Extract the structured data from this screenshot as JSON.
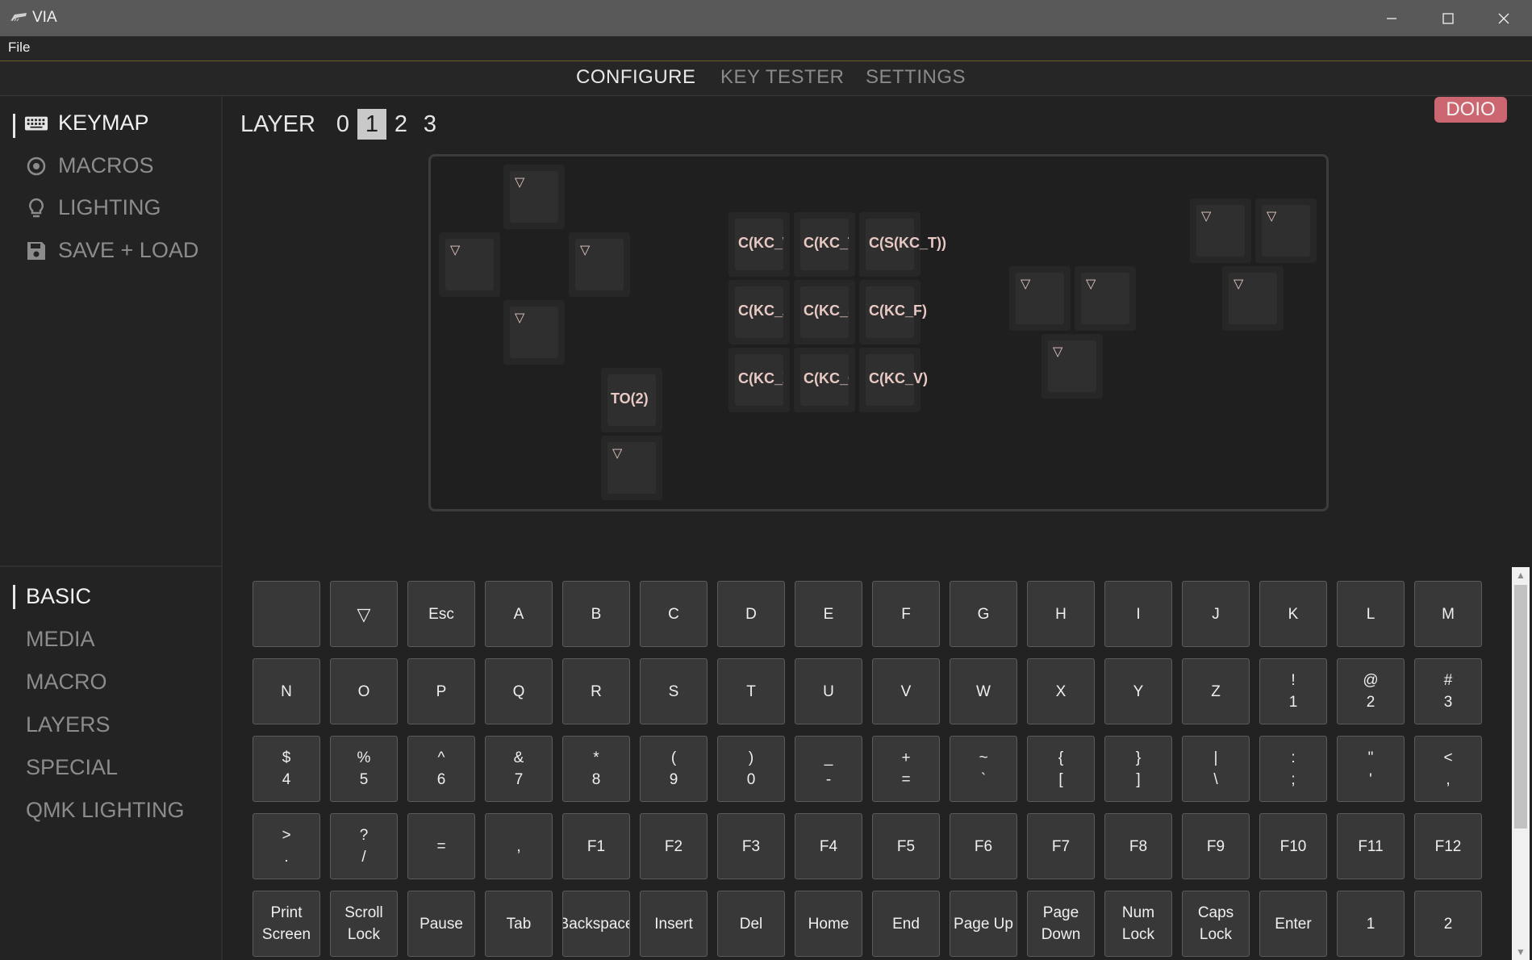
{
  "window": {
    "title": "VIA",
    "minimize": "—",
    "maximize": "☐",
    "close": "✕"
  },
  "menu": {
    "file": "File"
  },
  "nav": {
    "tabs": [
      "CONFIGURE",
      "KEY TESTER",
      "SETTINGS"
    ]
  },
  "sidebar": {
    "items": [
      "KEYMAP",
      "MACROS",
      "LIGHTING",
      "SAVE + LOAD"
    ],
    "categories": [
      "BASIC",
      "MEDIA",
      "MACRO",
      "LAYERS",
      "SPECIAL",
      "QMK LIGHTING"
    ]
  },
  "layer": {
    "label": "LAYER",
    "numbers": [
      "0",
      "1",
      "2",
      "3"
    ],
    "selected": "1"
  },
  "badge": "DOIO",
  "keyboard": {
    "transparent_symbol": "▽",
    "keys": [
      "C(KC_W",
      "C(KC_T",
      "C(S(KC_T))",
      "C(KC_Z",
      "C(KC_S",
      "C(KC_F)",
      "C(KC_X",
      "C(KC_C",
      "C(KC_V)",
      "TO(2)"
    ]
  },
  "keycodes": {
    "rows": [
      [
        "",
        "▽",
        "Esc",
        "A",
        "B",
        "C",
        "D",
        "E",
        "F",
        "G",
        "H",
        "I",
        "J",
        "K",
        "L",
        "M"
      ],
      [
        "N",
        "O",
        "P",
        "Q",
        "R",
        "S",
        "T",
        "U",
        "V",
        "W",
        "X",
        "Y",
        "Z",
        "!|1",
        "@|2",
        "#|3"
      ],
      [
        "$|4",
        "%|5",
        "^|6",
        "&|7",
        "*|8",
        "(|9",
        ")|0",
        "_|-",
        "+|=",
        "~|`",
        "{|[",
        "}|]",
        "||\\",
        ":|;",
        "\"|'",
        "<|,"
      ],
      [
        ">|.",
        "?|/",
        "=",
        ",",
        "F1",
        "F2",
        "F3",
        "F4",
        "F5",
        "F6",
        "F7",
        "F8",
        "F9",
        "F10",
        "F11",
        "F12"
      ],
      [
        "Print|Screen",
        "Scroll|Lock",
        "Pause",
        "Tab",
        "Backspace",
        "Insert",
        "Del",
        "Home",
        "End",
        "Page Up",
        "Page|Down",
        "Num|Lock",
        "Caps|Lock",
        "Enter",
        "1",
        "2"
      ]
    ]
  },
  "scrollbar": {
    "up": "▲",
    "down": "▼",
    "position": 0.04
  }
}
